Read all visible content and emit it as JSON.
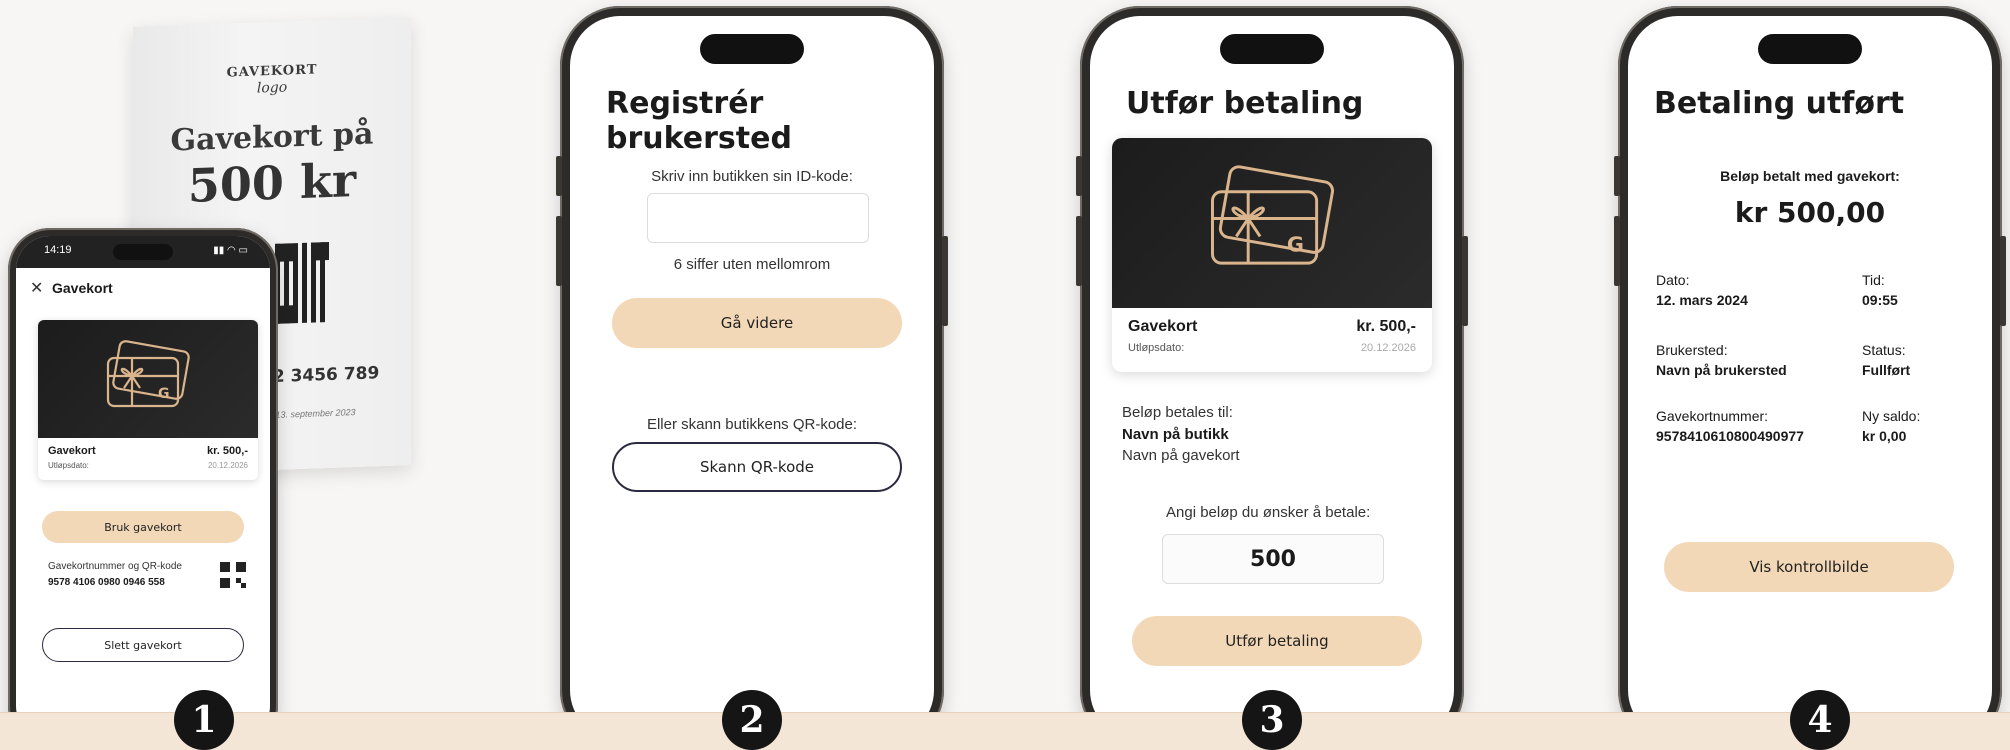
{
  "steps": [
    "1",
    "2",
    "3",
    "4"
  ],
  "leaflet": {
    "logo_top": "GAVEKORT",
    "logo_bottom": "logo",
    "title_line1": "Gavekort på",
    "title_line2": "500 kr",
    "code": "12 3456 789",
    "footnote": "ed 13. september 2023"
  },
  "phone1": {
    "time": "14:19",
    "header_title": "Gavekort",
    "card_name": "Gavekort",
    "card_amount": "kr. 500,-",
    "expiry_label": "Utløpsdato:",
    "expiry_date": "20.12.2026",
    "use_button": "Bruk gavekort",
    "number_label": "Gavekortnummer og QR-kode",
    "number_value": "9578 4106 0980 0946 558",
    "delete_button": "Slett gavekort"
  },
  "phone2": {
    "title": "Registrér brukersted",
    "prompt": "Skriv inn butikken sin ID-kode:",
    "input_value": "",
    "hint": "6 siffer uten mellomrom",
    "next_button": "Gå videre",
    "or_text": "Eller skann butikkens QR-kode:",
    "scan_button": "Skann QR-kode"
  },
  "phone3": {
    "title": "Utfør betaling",
    "card_name": "Gavekort",
    "card_amount": "kr. 500,-",
    "expiry_label": "Utløpsdato:",
    "expiry_date": "20.12.2026",
    "paid_to_label": "Beløp betales til:",
    "store_name": "Navn på butikk",
    "card_title": "Navn på gavekort",
    "amount_prompt": "Angi beløp du ønsker å betale:",
    "amount_value": "500",
    "pay_button": "Utfør betaling"
  },
  "phone4": {
    "title": "Betaling utført",
    "paid_label": "Beløp betalt med gavekort:",
    "paid_amount": "kr 500,00",
    "date_label": "Dato:",
    "date_value": "12. mars 2024",
    "time_label": "Tid:",
    "time_value": "09:55",
    "place_label": "Brukersted:",
    "place_value": "Navn på brukersted",
    "status_label": "Status:",
    "status_value": "Fullført",
    "number_label": "Gavekortnummer:",
    "number_value": "9578410610800490977",
    "balance_label": "Ny saldo:",
    "balance_value": "kr 0,00",
    "control_button": "Vis kontrollbilde"
  },
  "colors": {
    "accent_peach": "#f3d8b8",
    "band": "#f4e6d6",
    "dark": "#151515"
  }
}
